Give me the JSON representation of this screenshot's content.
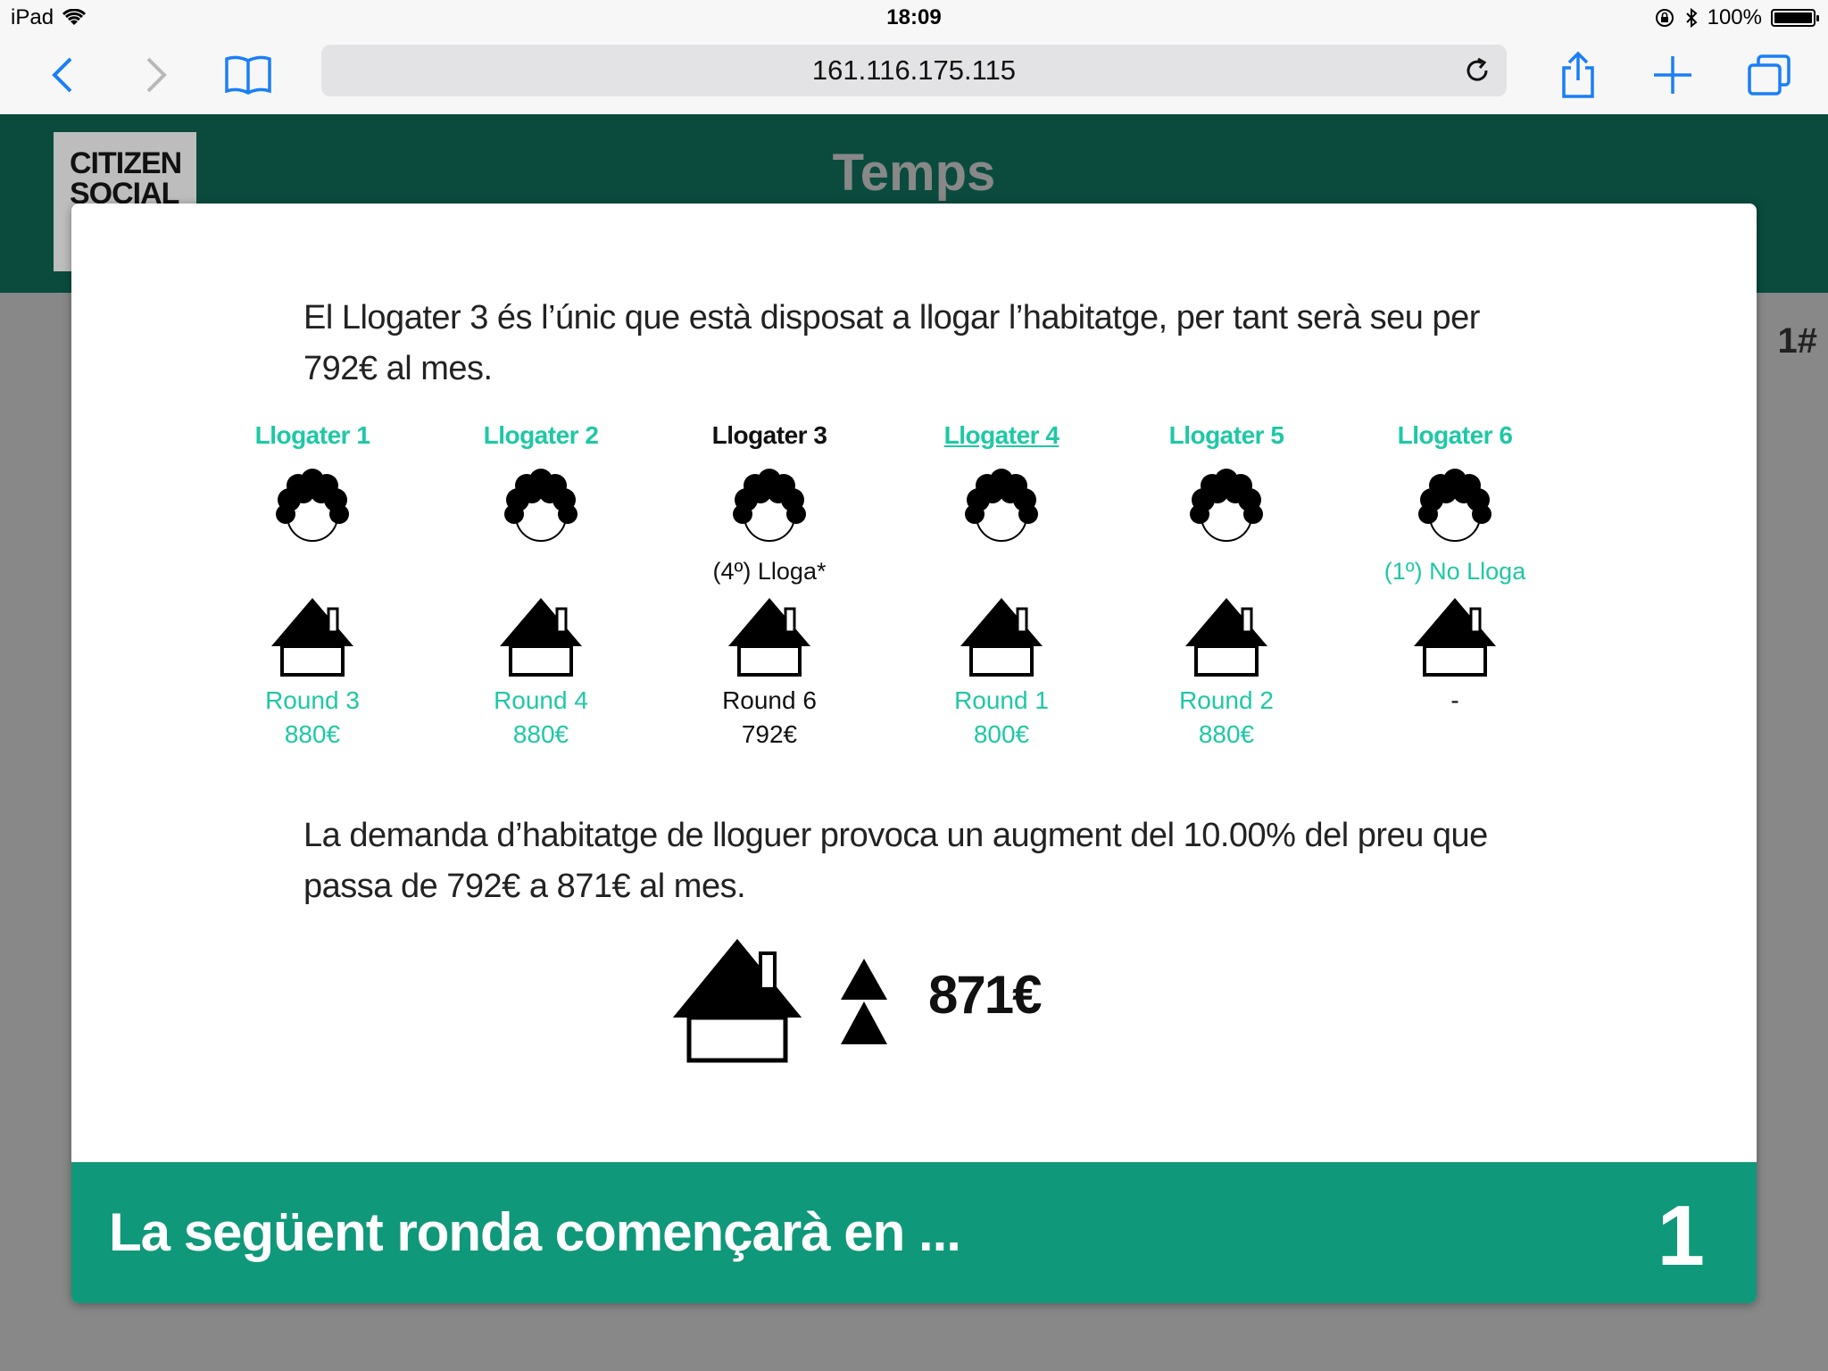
{
  "status_bar": {
    "device": "iPad",
    "time": "18:09",
    "battery": "100%",
    "battery_level": 1.0
  },
  "browser": {
    "url": "161.116.175.115"
  },
  "app": {
    "logo_line1": "CITIZEN",
    "logo_line2": "SOCIAL",
    "title": "Temps",
    "side_mark": "1#"
  },
  "modal": {
    "intro": "El Llogater 3 és l’únic que està disposat a llogar l’habitatge, per tant serà seu per 792€ al mes.",
    "tenants": [
      {
        "name": "Llogater 1",
        "status": "",
        "round": "Round 3",
        "price": "880€",
        "highlight": false,
        "underline": false
      },
      {
        "name": "Llogater 2",
        "status": "",
        "round": "Round 4",
        "price": "880€",
        "highlight": false,
        "underline": false
      },
      {
        "name": "Llogater 3",
        "status": "(4º) Lloga*",
        "round": "Round 6",
        "price": "792€",
        "highlight": true,
        "underline": false
      },
      {
        "name": "Llogater 4",
        "status": "",
        "round": "Round 1",
        "price": "800€",
        "highlight": false,
        "underline": true
      },
      {
        "name": "Llogater 5",
        "status": "",
        "round": "Round 2",
        "price": "880€",
        "highlight": false,
        "underline": false
      },
      {
        "name": "Llogater 6",
        "status": "(1º) No Lloga",
        "round": "-",
        "price": "",
        "highlight": false,
        "underline": false
      }
    ],
    "demand_text": "La demanda d’habitatge de lloguer provoca un augment del 10.00% del preu que passa de 792€ a 871€ al mes.",
    "new_price": "871€",
    "footer_message": "La següent ronda començarà en ...",
    "countdown": "1"
  },
  "colors": {
    "header_green": "#0a4b3e",
    "footer_green": "#10987a",
    "teal_text": "#1ec8a5"
  }
}
